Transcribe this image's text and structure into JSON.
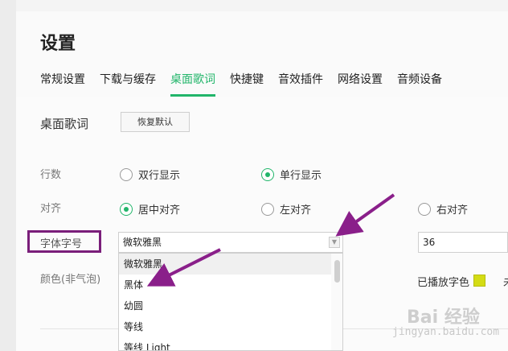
{
  "header": {
    "title": "设置",
    "tabs": [
      {
        "label": "常规设置",
        "active": false
      },
      {
        "label": "下载与缓存",
        "active": false
      },
      {
        "label": "桌面歌词",
        "active": true
      },
      {
        "label": "快捷键",
        "active": false
      },
      {
        "label": "音效插件",
        "active": false
      },
      {
        "label": "网络设置",
        "active": false
      },
      {
        "label": "音频设备",
        "active": false
      }
    ]
  },
  "section": {
    "title": "桌面歌词",
    "reset_label": "恢复默认"
  },
  "lines": {
    "label": "行数",
    "options": [
      {
        "label": "双行显示",
        "checked": false
      },
      {
        "label": "单行显示",
        "checked": true
      }
    ]
  },
  "align": {
    "label": "对齐",
    "options": [
      {
        "label": "居中对齐",
        "checked": true
      },
      {
        "label": "左对齐",
        "checked": false
      },
      {
        "label": "右对齐",
        "checked": false
      }
    ]
  },
  "font": {
    "label": "字体字号",
    "selected": "微软雅黑",
    "size": "36",
    "options": [
      "微软雅黑",
      "黑体",
      "幼圆",
      "等线",
      "等线 Light"
    ]
  },
  "color": {
    "label": "颜色(非气泡)",
    "played_label": "已播放字色",
    "played_color": "#d4dc14",
    "unplayed_fragment": "未"
  },
  "accent": "#21b56a",
  "highlight": "#7a1e7a",
  "watermark": {
    "text": "Bai 经验",
    "url": "jingyan.baidu.com"
  }
}
